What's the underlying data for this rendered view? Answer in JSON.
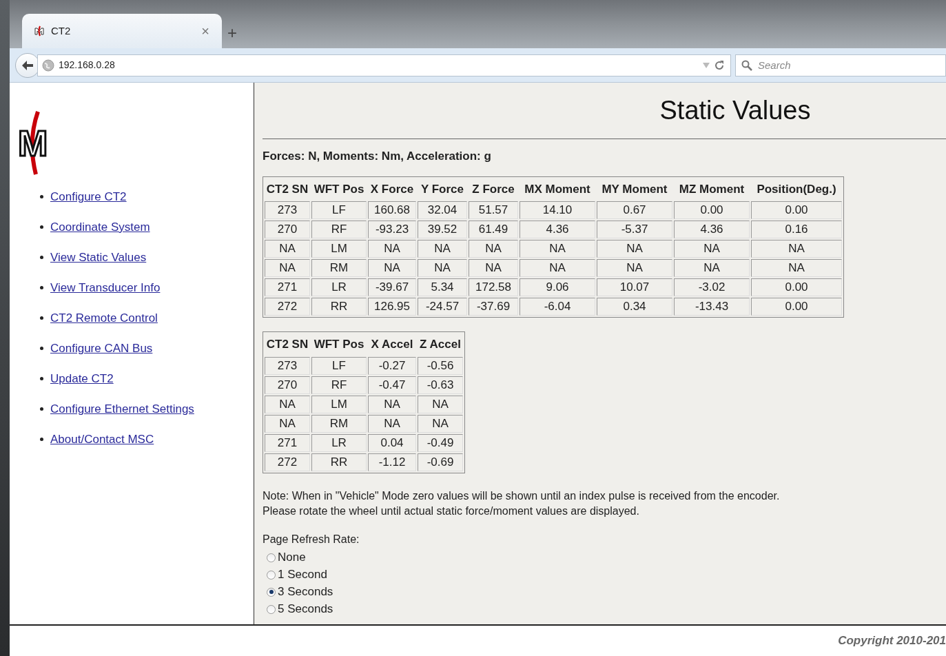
{
  "browser": {
    "tab": {
      "title": "CT2",
      "close": "×",
      "new_tab": "+"
    },
    "address": "192.168.0.28",
    "search": {
      "placeholder": "Search"
    }
  },
  "sidebar": {
    "logo": "M",
    "links": [
      "Configure CT2",
      "Coordinate System",
      "View Static Values",
      "View Transducer Info",
      "CT2 Remote Control",
      "Configure CAN Bus",
      "Update CT2",
      "Configure Ethernet Settings",
      "About/Contact MSC"
    ]
  },
  "page": {
    "title": "Static Values",
    "units": "Forces: N, Moments: Nm, Acceleration: g",
    "forces_table": {
      "columns": [
        "CT2 SN",
        "WFT Pos",
        "X Force",
        "Y Force",
        "Z Force",
        "MX Moment",
        "MY Moment",
        "MZ Moment",
        "Position(Deg.)"
      ],
      "rows": [
        [
          "273",
          "LF",
          "160.68",
          "32.04",
          "51.57",
          "14.10",
          "0.67",
          "0.00",
          "0.00"
        ],
        [
          "270",
          "RF",
          "-93.23",
          "39.52",
          "61.49",
          "4.36",
          "-5.37",
          "4.36",
          "0.16"
        ],
        [
          "NA",
          "LM",
          "NA",
          "NA",
          "NA",
          "NA",
          "NA",
          "NA",
          "NA"
        ],
        [
          "NA",
          "RM",
          "NA",
          "NA",
          "NA",
          "NA",
          "NA",
          "NA",
          "NA"
        ],
        [
          "271",
          "LR",
          "-39.67",
          "5.34",
          "172.58",
          "9.06",
          "10.07",
          "-3.02",
          "0.00"
        ],
        [
          "272",
          "RR",
          "126.95",
          "-24.57",
          "-37.69",
          "-6.04",
          "0.34",
          "-13.43",
          "0.00"
        ]
      ]
    },
    "accel_table": {
      "columns": [
        "CT2 SN",
        "WFT Pos",
        "X Accel",
        "Z Accel"
      ],
      "rows": [
        [
          "273",
          "LF",
          "-0.27",
          "-0.56"
        ],
        [
          "270",
          "RF",
          "-0.47",
          "-0.63"
        ],
        [
          "NA",
          "LM",
          "NA",
          "NA"
        ],
        [
          "NA",
          "RM",
          "NA",
          "NA"
        ],
        [
          "271",
          "LR",
          "0.04",
          "-0.49"
        ],
        [
          "272",
          "RR",
          "-1.12",
          "-0.69"
        ]
      ]
    },
    "note": [
      "Note: When in \"Vehicle\" Mode zero values will be shown until an index pulse is received from the encoder.",
      "Please rotate the wheel until actual static force/moment values are displayed."
    ],
    "refresh": {
      "label": "Page Refresh Rate:",
      "options": [
        {
          "label": "None",
          "selected": false
        },
        {
          "label": "1 Second",
          "selected": false
        },
        {
          "label": "3 Seconds",
          "selected": true
        },
        {
          "label": "5 Seconds",
          "selected": false
        }
      ]
    }
  },
  "footer": {
    "copyright": "Copyright 2010-201"
  }
}
